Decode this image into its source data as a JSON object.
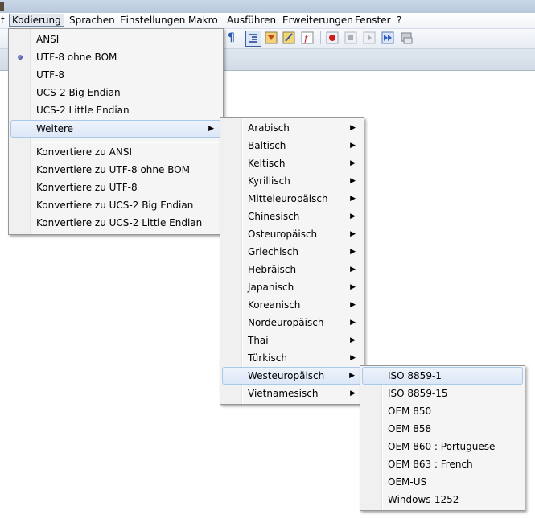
{
  "menubar": {
    "items": [
      {
        "label": "t"
      },
      {
        "label": "Kodierung"
      },
      {
        "label": "Sprachen"
      },
      {
        "label": "Einstellungen"
      },
      {
        "label": "Makro"
      },
      {
        "label": "Ausführen"
      },
      {
        "label": "Erweiterungen"
      },
      {
        "label": "Fenster"
      },
      {
        "label": "?"
      }
    ]
  },
  "toolbar": {
    "icons": [
      "pilcrow-icon",
      "indent-guide-icon",
      "fold-icon",
      "doc-map-icon",
      "function-list-icon",
      "record-macro-icon",
      "stop-macro-icon",
      "play-macro-icon",
      "run-macro-multiple-icon",
      "save-macro-icon"
    ]
  },
  "kodierung_menu": {
    "items": [
      {
        "label": "ANSI"
      },
      {
        "label": "UTF-8 ohne BOM"
      },
      {
        "label": "UTF-8"
      },
      {
        "label": "UCS-2 Big Endian"
      },
      {
        "label": "UCS-2 Little Endian"
      },
      {
        "label": "Weitere"
      },
      {
        "label": "Konvertiere zu ANSI"
      },
      {
        "label": "Konvertiere zu UTF-8 ohne BOM"
      },
      {
        "label": "Konvertiere zu UTF-8"
      },
      {
        "label": "Konvertiere zu UCS-2 Big Endian"
      },
      {
        "label": "Konvertiere zu UCS-2 Little Endian"
      }
    ],
    "selected": "UTF-8 ohne BOM"
  },
  "weitere_menu": {
    "items": [
      {
        "label": "Arabisch"
      },
      {
        "label": "Baltisch"
      },
      {
        "label": "Keltisch"
      },
      {
        "label": "Kyrillisch"
      },
      {
        "label": "Mitteleuropäisch"
      },
      {
        "label": "Chinesisch"
      },
      {
        "label": "Osteuropäisch"
      },
      {
        "label": "Griechisch"
      },
      {
        "label": "Hebräisch"
      },
      {
        "label": "Japanisch"
      },
      {
        "label": "Koreanisch"
      },
      {
        "label": "Nordeuropäisch"
      },
      {
        "label": "Thai"
      },
      {
        "label": "Türkisch"
      },
      {
        "label": "Westeuropäisch"
      },
      {
        "label": "Vietnamesisch"
      }
    ]
  },
  "westeuropaeisch_menu": {
    "items": [
      {
        "label": "ISO 8859-1"
      },
      {
        "label": "ISO 8859-15"
      },
      {
        "label": "OEM 850"
      },
      {
        "label": "OEM 858"
      },
      {
        "label": "OEM 860 : Portuguese"
      },
      {
        "label": "OEM 863 : French"
      },
      {
        "label": "OEM-US"
      },
      {
        "label": "Windows-1252"
      }
    ]
  },
  "arrow_glyph": "▶"
}
